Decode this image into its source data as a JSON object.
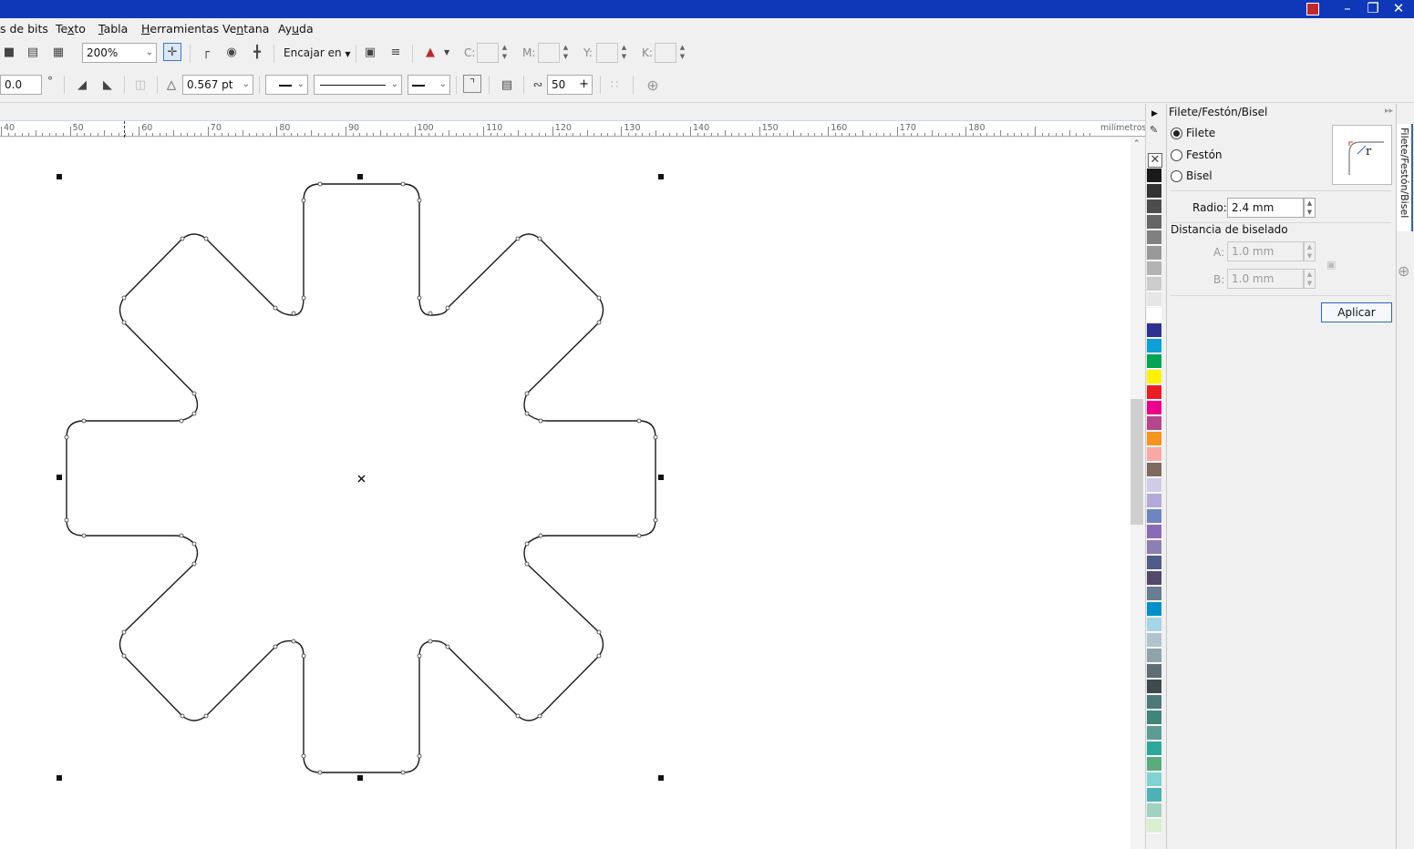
{
  "menu": {
    "items": [
      {
        "pre": "s de bits",
        "ul": "",
        "post": ""
      },
      {
        "pre": "Te",
        "ul": "x",
        "post": "to"
      },
      {
        "pre": "",
        "ul": "T",
        "post": "abla"
      },
      {
        "pre": "",
        "ul": "H",
        "post": "erramientas"
      },
      {
        "pre": "Ve",
        "ul": "n",
        "post": "tana"
      },
      {
        "pre": "Ay",
        "ul": "u",
        "post": "da"
      }
    ]
  },
  "toolbar1": {
    "zoom": "200%",
    "snap_label": "Encajar en",
    "c_label": "C:",
    "m_label": "M:",
    "y_label": "Y:",
    "k_label": "K:"
  },
  "toolbar2": {
    "angle_value": "0.0",
    "angle_unit": "°",
    "outline_width": "0.567 pt",
    "smooth_value": "50"
  },
  "ruler": {
    "unit_label": "milímetros",
    "labels": [
      "40",
      "50",
      "60",
      "70",
      "80",
      "90",
      "100",
      "110",
      "120",
      "130",
      "140",
      "150",
      "160",
      "170",
      "180"
    ]
  },
  "docker": {
    "title": "Filete/Festón/Bisel",
    "options": [
      {
        "label": "Filete",
        "selected": true
      },
      {
        "label": "Festón",
        "selected": false
      },
      {
        "label": "Bisel",
        "selected": false
      }
    ],
    "radius_label": "Radio:",
    "radius_value": "2.4 mm",
    "bevel_heading": "Distancia de biselado",
    "a_label": "A:",
    "a_value": "1.0 mm",
    "b_label": "B:",
    "b_value": "1.0 mm",
    "apply_label": "Aplicar",
    "preview_letter": "r",
    "vertical_tab": "Filete/Festón/Bisel"
  },
  "palette": {
    "colors": [
      "#1a1a1a",
      "#333333",
      "#4d4d4d",
      "#666666",
      "#808080",
      "#999999",
      "#b3b3b3",
      "#cccccc",
      "#e6e6e6",
      "#ffffff",
      "#2e3192",
      "#0ba0d8",
      "#00a651",
      "#fff200",
      "#ed1c24",
      "#ec008c",
      "#b5478f",
      "#f7941d",
      "#f9a8a6",
      "#7f6a5f",
      "#cfcbe8",
      "#b3a8d9",
      "#6d85c2",
      "#8a6ab8",
      "#8c7fb5",
      "#505b8c",
      "#52496b",
      "#687d91",
      "#0090c9",
      "#a4d6e8",
      "#b0c4cf",
      "#8ea3ac",
      "#5d6d73",
      "#3f4a4d",
      "#4c7a7a",
      "#3f8578",
      "#5d9c94",
      "#2da89c",
      "#58ac7c",
      "#7fd3d3",
      "#4bb3b8",
      "#a0d2c0",
      "#d8f0d0"
    ]
  }
}
